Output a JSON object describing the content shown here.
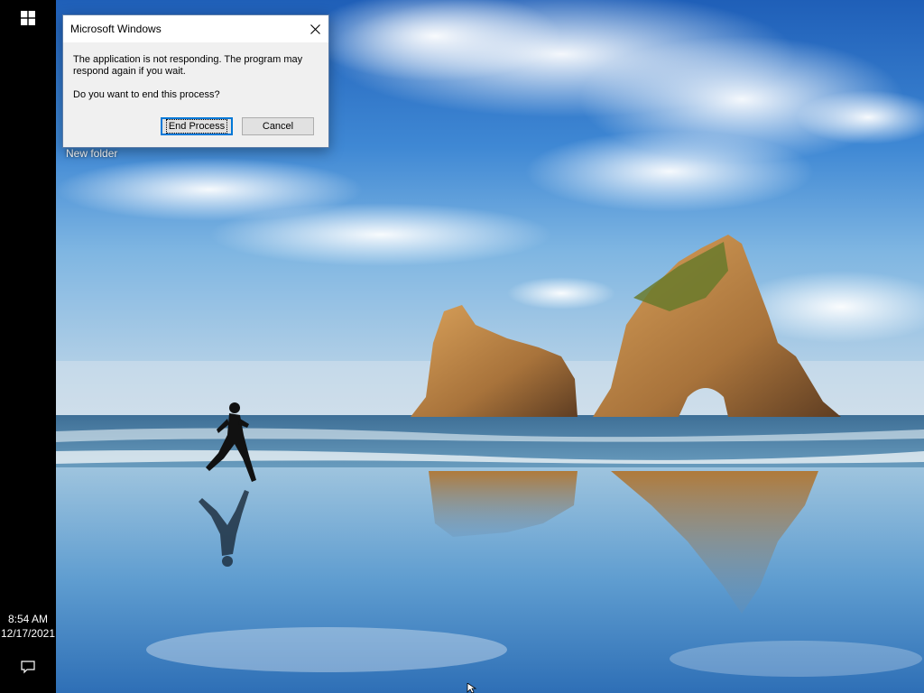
{
  "dialog": {
    "title": "Microsoft Windows",
    "message": "The application is not responding. The program may respond again if you wait.",
    "question": "Do you want to end this process?",
    "end_process_label": "End Process",
    "cancel_label": "Cancel"
  },
  "desktop": {
    "icon_label": "New folder"
  },
  "taskbar": {
    "time": "8:54 AM",
    "date": "12/17/2021"
  },
  "colors": {
    "taskbar": "#000000",
    "dialog_bg": "#f0f0f0",
    "accent": "#0078d7"
  }
}
